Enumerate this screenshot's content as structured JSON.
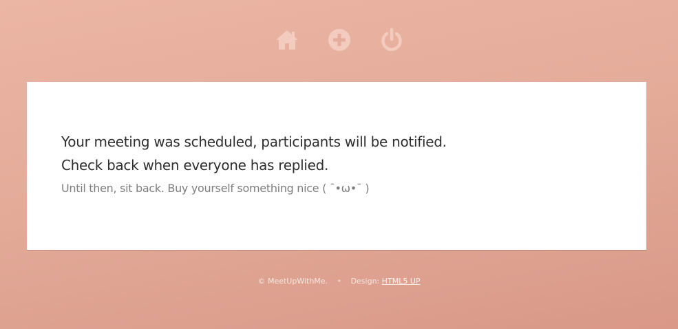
{
  "nav": {
    "items": [
      {
        "icon": "home-icon"
      },
      {
        "icon": "plus-circle-icon"
      },
      {
        "icon": "power-icon"
      }
    ]
  },
  "message": {
    "line1": "Your meeting was scheduled, participants will be notified.",
    "line2": "Check back when everyone has replied.",
    "subtext": "Until then, sit back. Buy yourself something nice ( ˉ•ω•ˉ )"
  },
  "footer": {
    "copyright": "© MeetUpWithMe.",
    "separator": "•",
    "design_label": "Design: ",
    "design_link": "HTML5 UP"
  },
  "colors": {
    "background": "#e3aa98",
    "icon": "#f2c9bc",
    "card": "#ffffff"
  }
}
